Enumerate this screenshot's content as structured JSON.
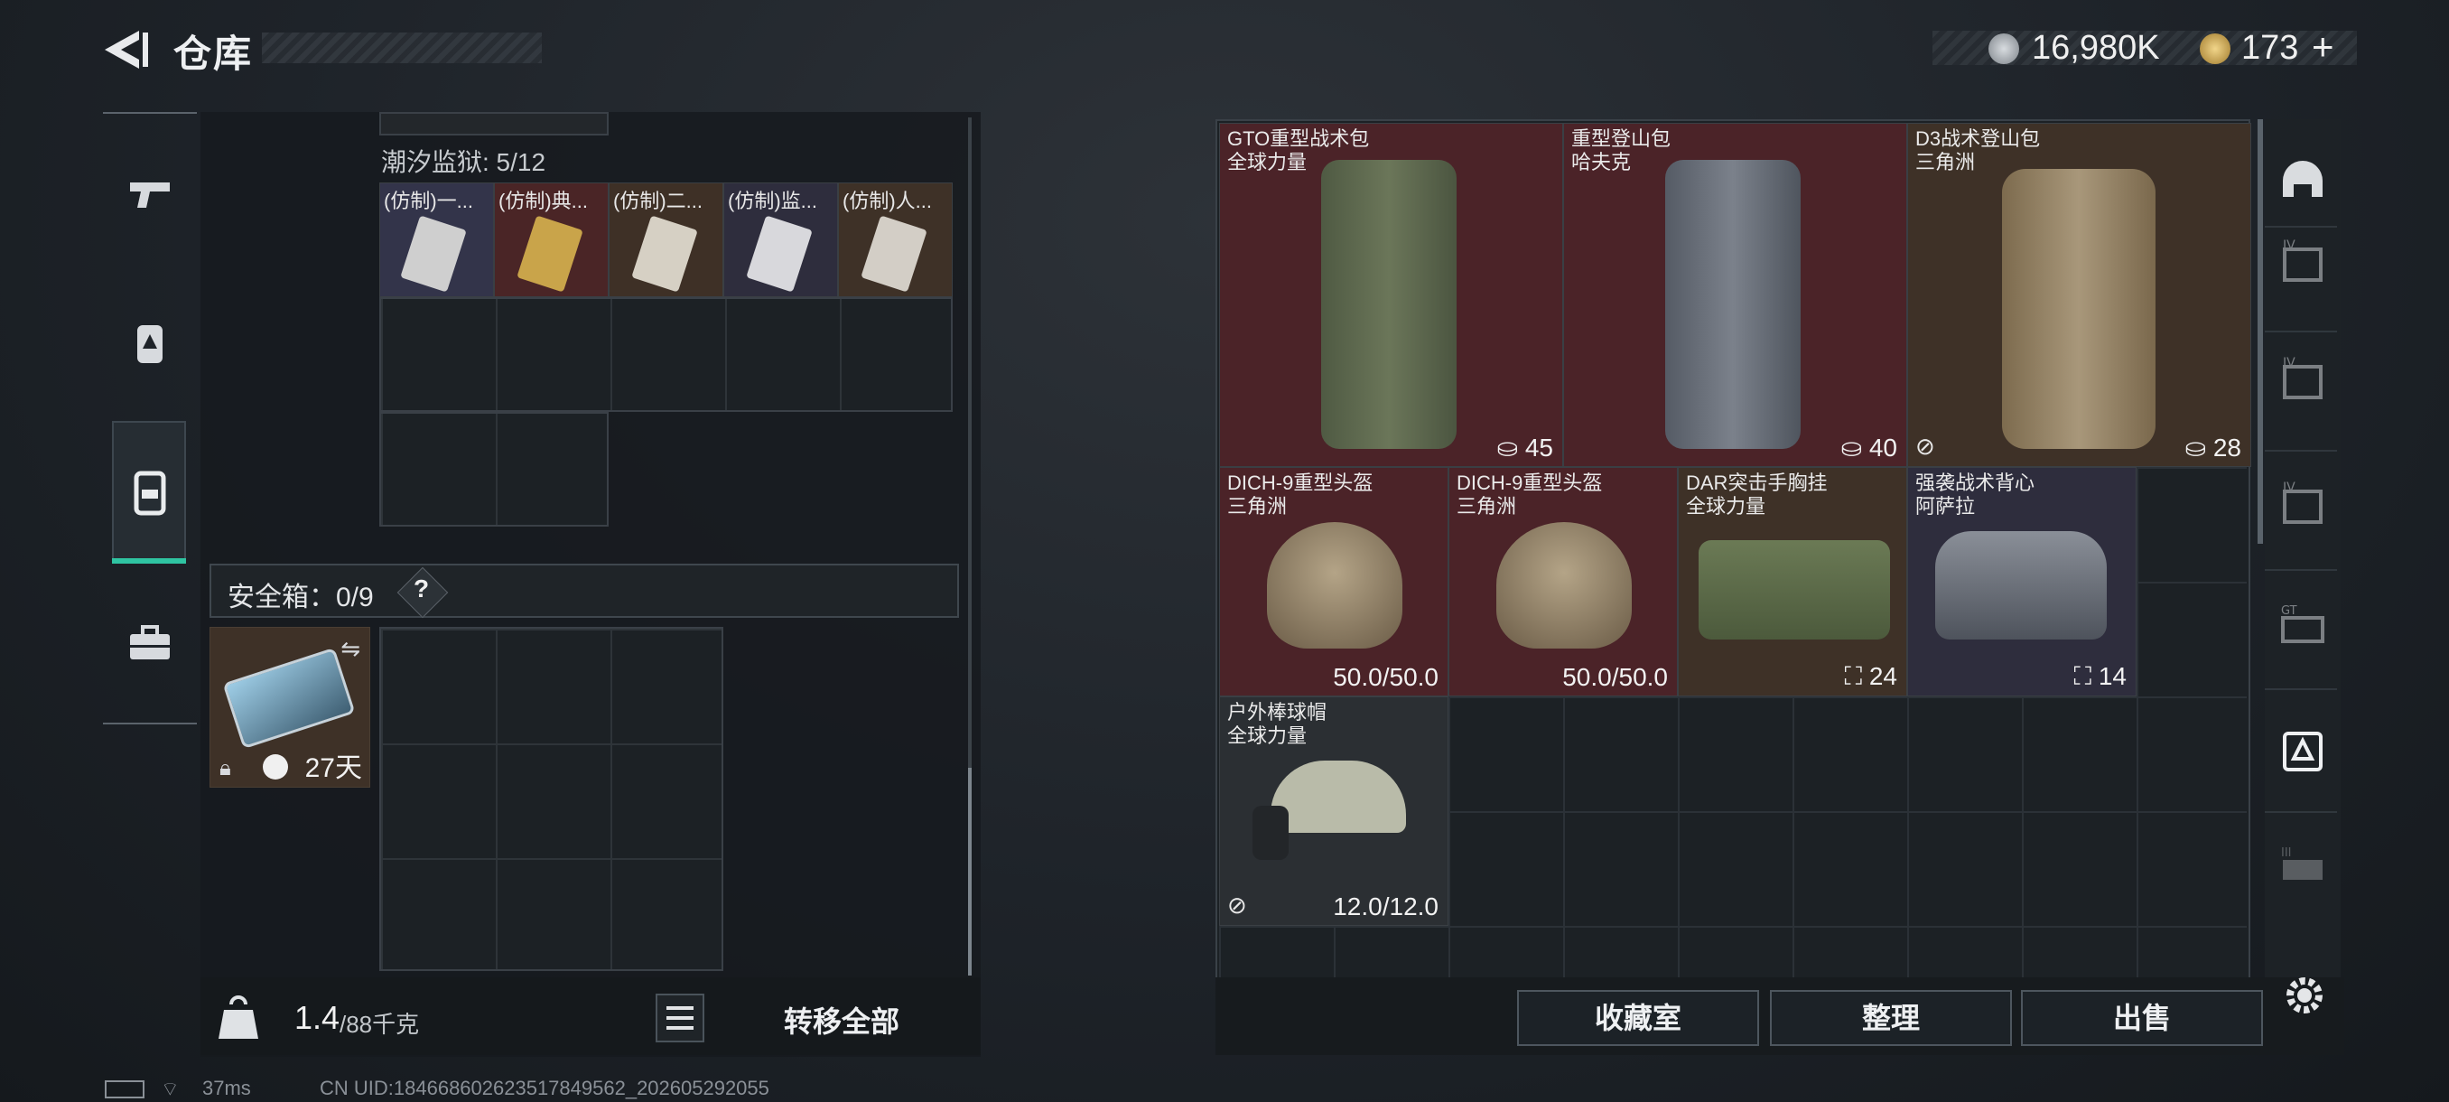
{
  "header": {
    "title": "仓库",
    "currency1": "16,980K",
    "currency2": "173",
    "plus": "+"
  },
  "sidebar": {
    "items": [
      "firearm-icon",
      "armor-icon",
      "backpack-icon",
      "toolbox-icon"
    ],
    "active": 2
  },
  "left": {
    "prison_label": "潮汐监狱: 5/12",
    "items": [
      "(仿制)一...",
      "(仿制)典...",
      "(仿制)二...",
      "(仿制)监...",
      "(仿制)人..."
    ],
    "safe_label": "安全箱：0/9",
    "help": "?",
    "safe_days": "27天",
    "weight": "1.4",
    "weight_cap": "/88千克",
    "transfer_all": "转移全部"
  },
  "right": {
    "tiles": [
      {
        "name": "GTO重型战术包",
        "brand": "全球力量",
        "value": "45"
      },
      {
        "name": "重型登山包",
        "brand": "哈夫克",
        "value": "40"
      },
      {
        "name": "D3战术登山包",
        "brand": "三角洲",
        "value": "28"
      },
      {
        "name": "DICH-9重型头盔",
        "brand": "三角洲",
        "value": "50.0/50.0"
      },
      {
        "name": "DICH-9重型头盔",
        "brand": "三角洲",
        "value": "50.0/50.0"
      },
      {
        "name": "DAR突击手胸挂",
        "brand": "全球力量",
        "value": "24"
      },
      {
        "name": "强袭战术背心",
        "brand": "阿萨拉",
        "value": "14"
      },
      {
        "name": "户外棒球帽",
        "brand": "全球力量",
        "value": "12.0/12.0"
      }
    ],
    "buttons": {
      "collection": "收藏室",
      "organize": "整理",
      "sell": "出售"
    }
  },
  "status": {
    "ping": "37ms",
    "uid": "CN UID:184668602623517849562_202605292055"
  },
  "colors": {
    "accent": "#2fc4a2",
    "red_tile": "#4b2328",
    "brown_tile": "#3e3127",
    "purple_tile": "#2e2d3d"
  }
}
